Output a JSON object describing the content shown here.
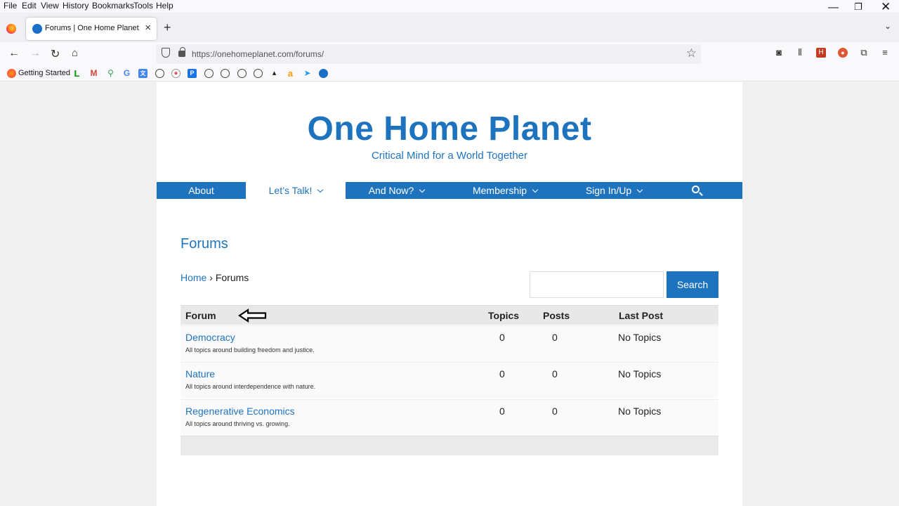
{
  "browser": {
    "menus": [
      "File",
      "Edit",
      "View",
      "History",
      "Bookmarks",
      "Tools",
      "Help"
    ],
    "tab_title": "Forums | One Home Planet",
    "url": "https://onehomeplanet.com/forums/",
    "bookmark_label": "Getting Started"
  },
  "site": {
    "title": "One Home Planet",
    "tagline": "Critical Mind for a World Together",
    "nav": [
      "About",
      "Let’s Talk!",
      "And Now?",
      "Membership",
      "Sign In/Up"
    ]
  },
  "page": {
    "title": "Forums",
    "breadcrumb": {
      "home": "Home",
      "separator": "›",
      "current": "Forums"
    },
    "search_button": "Search"
  },
  "table": {
    "headers": {
      "forum": "Forum",
      "topics": "Topics",
      "posts": "Posts",
      "last_post": "Last Post"
    },
    "rows": [
      {
        "name": "Democracy",
        "description": "All topics around building freedom and justice.",
        "topics": "0",
        "posts": "0",
        "last_post": "No Topics"
      },
      {
        "name": "Nature",
        "description": "All topics around interdependence with nature.",
        "topics": "0",
        "posts": "0",
        "last_post": "No Topics"
      },
      {
        "name": "Regenerative Economics",
        "description": "All topics around thriving vs. growing.",
        "topics": "0",
        "posts": "0",
        "last_post": "No Topics"
      }
    ]
  },
  "colors": {
    "brand": "#1e73be"
  }
}
